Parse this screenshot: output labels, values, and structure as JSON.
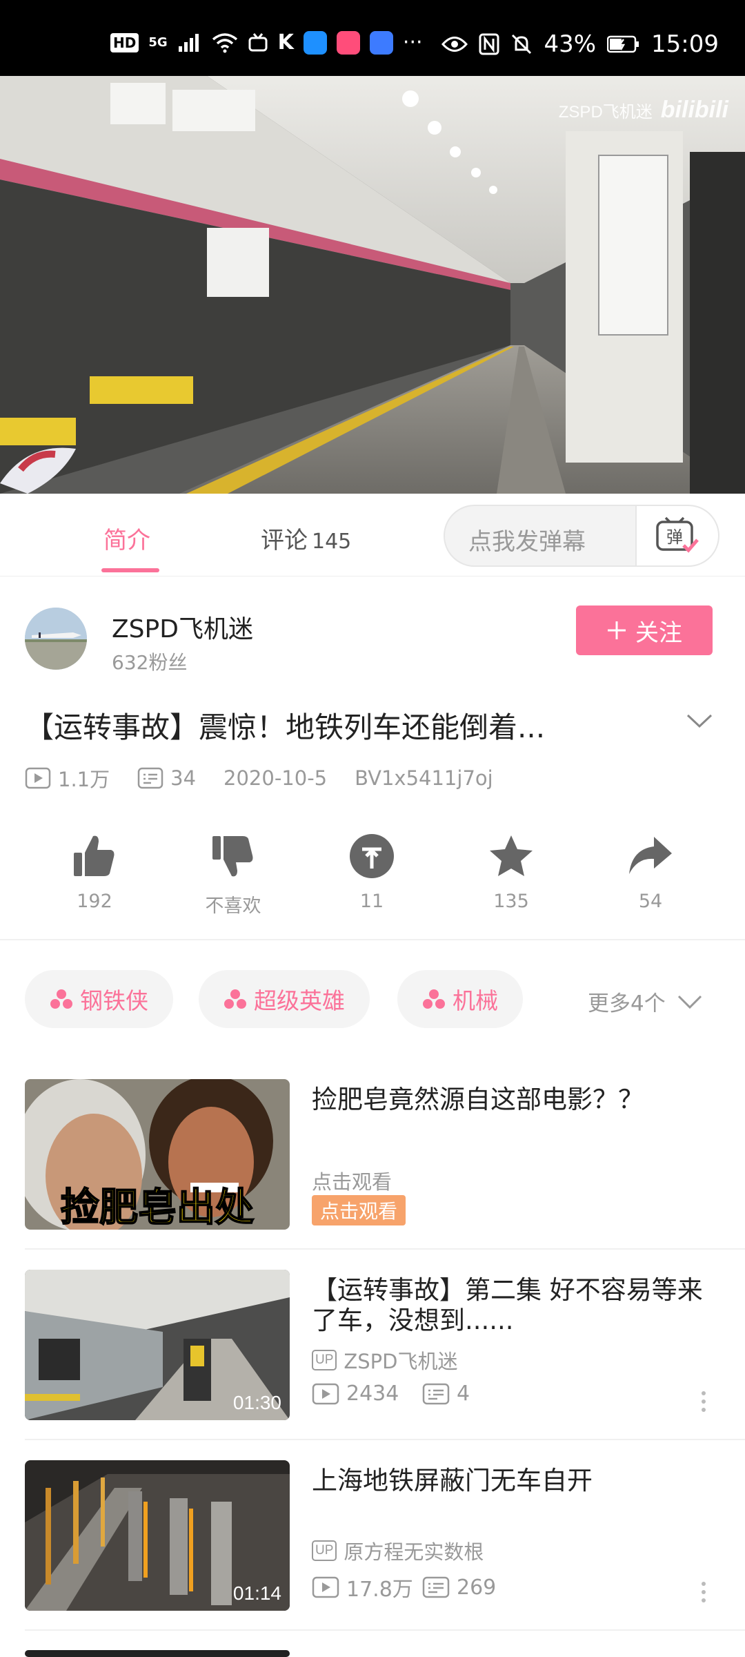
{
  "status_bar": {
    "hd": "HD",
    "network": "5G",
    "more": "···",
    "battery": "43%",
    "time": "15:09"
  },
  "video": {
    "watermark_user": "ZSPD飞机迷",
    "watermark_brand": "bilibili"
  },
  "tabs": {
    "intro": "简介",
    "comments": "评论",
    "comments_count": "145"
  },
  "danmaku": {
    "placeholder": "点我发弹幕",
    "button_glyph": "弹"
  },
  "uploader": {
    "name": "ZSPD飞机迷",
    "fans": "632粉丝",
    "follow_label": "关注"
  },
  "video_info": {
    "title": "【运转事故】震惊！地铁列车还能倒着...",
    "views": "1.1万",
    "danmaku_count": "34",
    "date": "2020-10-5",
    "bvid": "BV1x5411j7oj"
  },
  "actions": {
    "like": "192",
    "dislike": "不喜欢",
    "coin": "11",
    "favorite": "135",
    "share": "54"
  },
  "tags": [
    "钢铁侠",
    "超级英雄",
    "机械"
  ],
  "more_tags": "更多4个",
  "recommendations": [
    {
      "title": "捡肥皂竟然源自这部电影？？",
      "thumb_caption": "捡肥皂出处",
      "subtitle": "点击观看",
      "badge": "点击观看"
    },
    {
      "title": "【运转事故】第二集 好不容易等来了车，没想到......",
      "up": "ZSPD飞机迷",
      "views": "2434",
      "danmaku": "4",
      "duration": "01:30"
    },
    {
      "title": "上海地铁屏蔽门无车自开",
      "up": "原方程无实数根",
      "views": "17.8万",
      "danmaku": "269",
      "duration": "01:14"
    }
  ],
  "colors": {
    "accent": "#fb7299",
    "ad": "#f7a36b",
    "muted": "#999999"
  }
}
